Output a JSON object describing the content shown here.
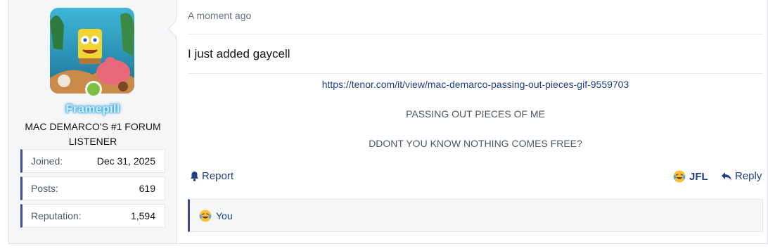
{
  "user": {
    "username": "Framepill",
    "title": "MAC DEMARCO'S #1 FORUM LISTENER",
    "online": true,
    "stats": [
      {
        "label": "Joined:",
        "value": "Dec 31, 2025"
      },
      {
        "label": "Posts:",
        "value": "619"
      },
      {
        "label": "Reputation:",
        "value": "1,594"
      }
    ]
  },
  "post": {
    "date": "A moment ago",
    "lead": "I just added gaycell",
    "link": "https://tenor.com/it/view/mac-demarco-passing-out-pieces-gif-9559703",
    "line1": "PASSING OUT PIECES OF ME",
    "line2": "DDONT YOU KNOW NOTHING COMES FREE?"
  },
  "actions": {
    "report": "Report",
    "jfl": "JFL",
    "reply": "Reply"
  },
  "reactions": {
    "summary": "You"
  },
  "colors": {
    "accent": "#3b4a8f",
    "link": "#1f3f82",
    "online": "#7bc043",
    "username_glow": "#1da1e6"
  }
}
